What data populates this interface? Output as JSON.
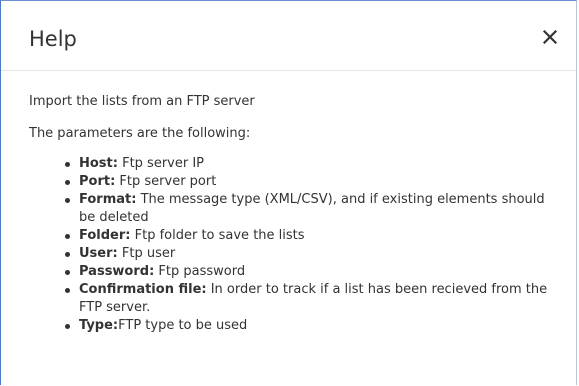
{
  "dialog": {
    "title": "Help",
    "close_icon": "close-icon",
    "intro": "Import the lists from an FTP server",
    "params_heading": "The parameters are the following:",
    "items": [
      {
        "term": "Host:",
        "desc": " Ftp server IP"
      },
      {
        "term": "Port:",
        "desc": " Ftp server port"
      },
      {
        "term": "Format:",
        "desc": " The message type (XML/CSV), and if existing elements should be deleted"
      },
      {
        "term": "Folder:",
        "desc": " Ftp folder to save the lists"
      },
      {
        "term": "User:",
        "desc": " Ftp user"
      },
      {
        "term": "Password:",
        "desc": " Ftp password"
      },
      {
        "term": "Confirmation file:",
        "desc": " In order to track if a list has been recieved from the FTP server."
      },
      {
        "term": "Type:",
        "desc": "FTP type to be used"
      }
    ]
  },
  "colors": {
    "text": "#333333",
    "accent_border": "#4a78c8",
    "divider": "#e5e5e5"
  }
}
